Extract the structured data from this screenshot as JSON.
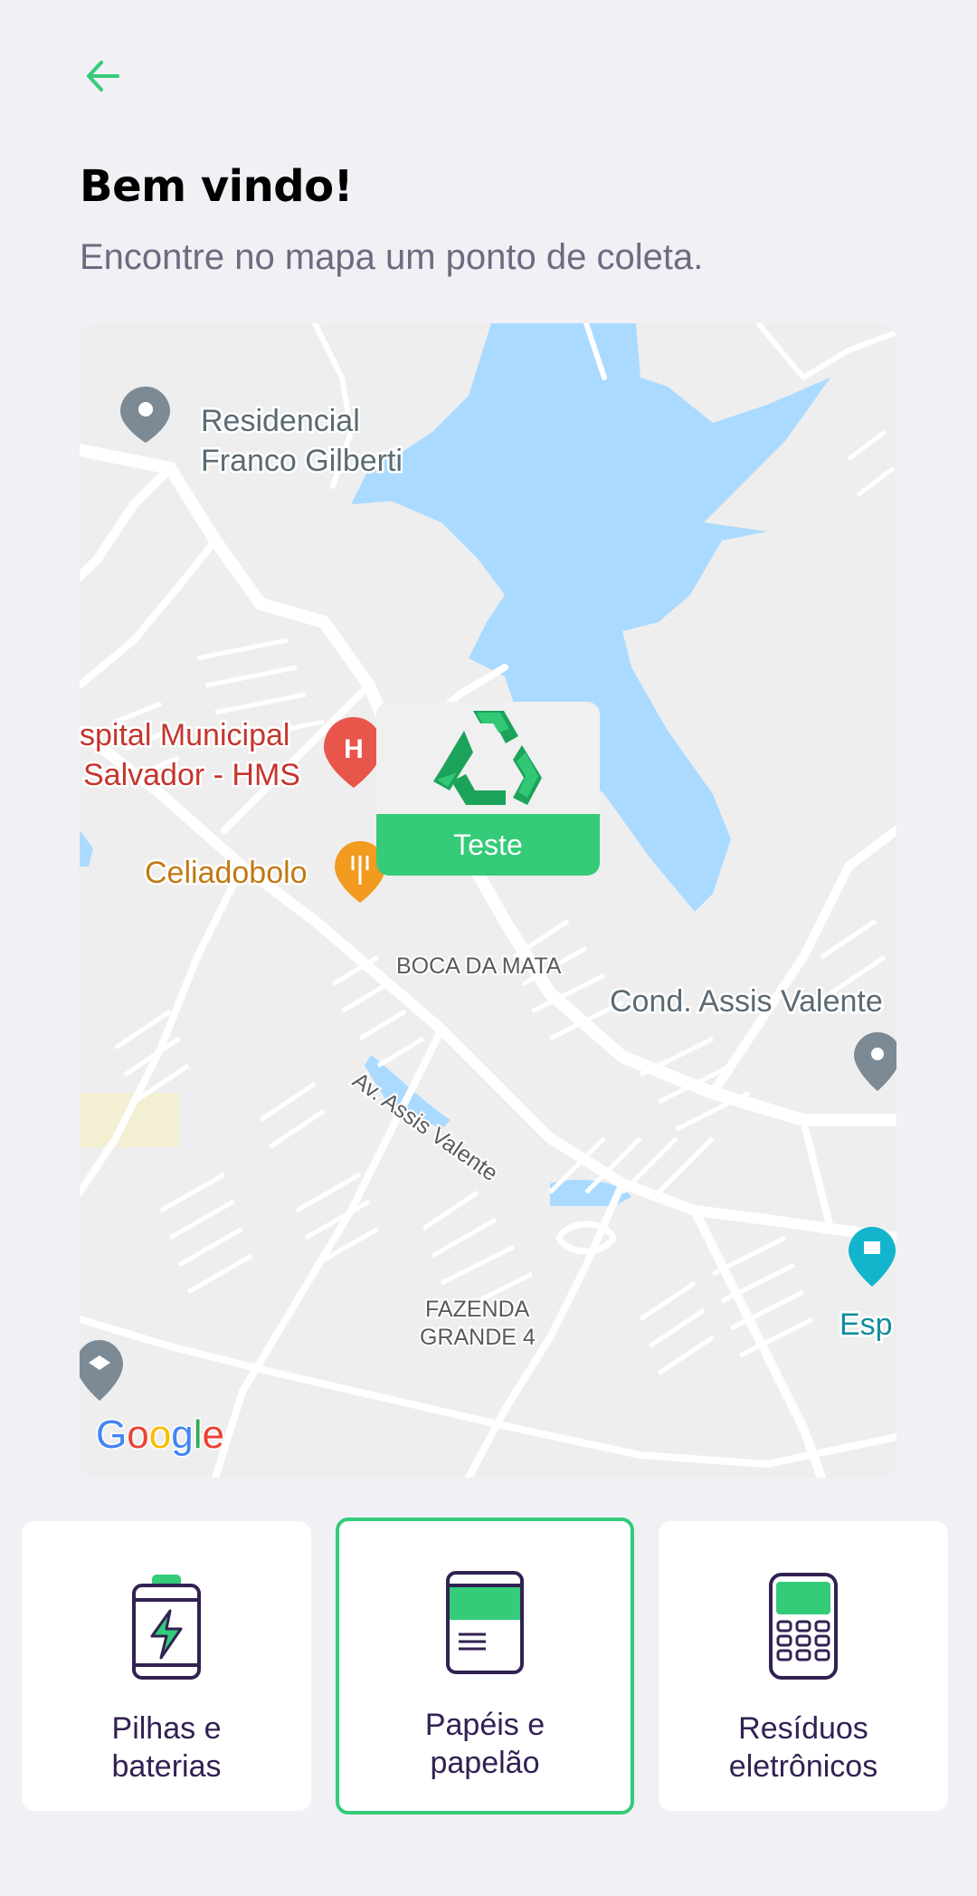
{
  "header": {
    "back_icon": "arrow-left-icon",
    "title": "Bem vindo!",
    "subtitle": "Encontre no mapa um ponto de coleta."
  },
  "map": {
    "labels": {
      "residencial": "Residencial",
      "franco": "Franco Gilberti",
      "hospital1": "spital Municipal",
      "hospital2": "Salvador - HMS",
      "celiadobolo": "Celiadobolo",
      "boca_da_mata": "BOCA DA MATA",
      "cond": "Cond. Assis Valente",
      "avenida": "Av. Assis Valente",
      "fazenda1": "FAZENDA",
      "fazenda2": "GRANDE 4",
      "esp": "Esp"
    },
    "logo": "Google",
    "marker": {
      "label": "Teste",
      "icon": "recycle-icon"
    }
  },
  "items": [
    {
      "label": "Pilhas e\nbaterias",
      "icon": "battery-icon",
      "selected": false
    },
    {
      "label": "Papéis e\npapelão",
      "icon": "paper-icon",
      "selected": true
    },
    {
      "label": "Resíduos\neletrônicos",
      "icon": "electronics-icon",
      "selected": false
    }
  ],
  "colors": {
    "accent": "#34CB79",
    "text": "#322153",
    "subtitle": "#6C6C80",
    "background": "#F0F0F5",
    "water": "#AADAFF"
  }
}
